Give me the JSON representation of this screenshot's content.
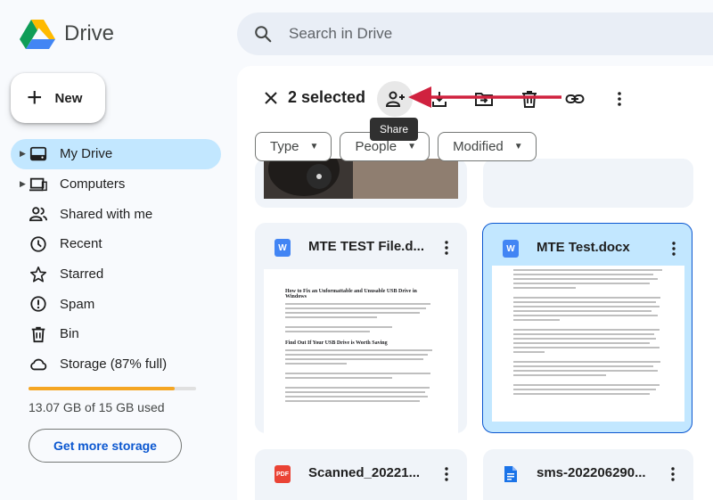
{
  "app": {
    "name": "Drive"
  },
  "search": {
    "placeholder": "Search in Drive"
  },
  "new_button": {
    "label": "New"
  },
  "sidebar": {
    "items": [
      {
        "label": "My Drive",
        "icon": "my-drive-icon",
        "active": true,
        "expandable": true
      },
      {
        "label": "Computers",
        "icon": "computer-icon",
        "active": false,
        "expandable": true
      },
      {
        "label": "Shared with me",
        "icon": "people-icon",
        "active": false,
        "expandable": false
      },
      {
        "label": "Recent",
        "icon": "clock-icon",
        "active": false,
        "expandable": false
      },
      {
        "label": "Starred",
        "icon": "star-icon",
        "active": false,
        "expandable": false
      },
      {
        "label": "Spam",
        "icon": "spam-icon",
        "active": false,
        "expandable": false
      },
      {
        "label": "Bin",
        "icon": "trash-icon",
        "active": false,
        "expandable": false
      },
      {
        "label": "Storage (87% full)",
        "icon": "cloud-icon",
        "active": false,
        "expandable": false
      }
    ]
  },
  "storage": {
    "used_fraction": 0.87,
    "text": "13.07 GB of 15 GB used",
    "button_label": "Get more storage"
  },
  "selection": {
    "count_label": "2 selected",
    "tooltip": "Share"
  },
  "filters": [
    "Type",
    "People",
    "Modified"
  ],
  "files": [
    {
      "name": "MTE TEST File.d...",
      "type_badge": "W",
      "badge_color": "#4285f4",
      "selected": false,
      "heading1": "How to Fix an Unformattable and Unusable USB Drive in Windows",
      "heading2": "Find Out If Your USB Drive is Worth Saving"
    },
    {
      "name": "MTE Test.docx",
      "type_badge": "W",
      "badge_color": "#4285f4",
      "selected": true
    },
    {
      "name": "Scanned_20221...",
      "type_badge": "PDF",
      "badge_color": "#ea4335",
      "selected": false
    },
    {
      "name": "sms-202206290...",
      "type_badge": "",
      "badge_color": "#1a73e8",
      "selected": false
    }
  ],
  "colors": {
    "accent": "#0b57d0",
    "active_bg": "#c2e7ff",
    "arrow": "#d0223f"
  }
}
